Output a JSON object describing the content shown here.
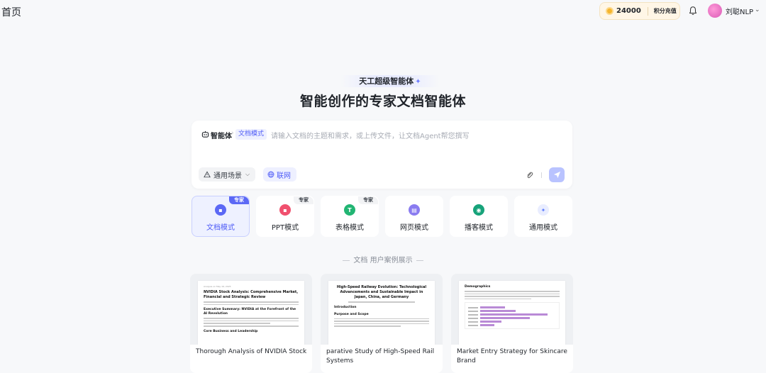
{
  "header": {
    "page_title": "首页",
    "credits": "24000",
    "recharge_label": "积分充值",
    "username": "刘聪NLP"
  },
  "hero": {
    "badge": "天工超级智能体",
    "title": "智能创作的专家文档智能体"
  },
  "composer": {
    "agent_label": "智能体",
    "mode_chip": "文档模式",
    "placeholder": "请输入文档的主题和需求，或上传文件，让文档Agent帮您撰写",
    "scene_label": "通用场景",
    "web_label": "联网"
  },
  "modes": [
    {
      "label": "文档模式",
      "tag": "专家",
      "icon": "doc-icon",
      "color": "#5b68f5"
    },
    {
      "label": "PPT模式",
      "tag": "专家",
      "icon": "ppt-icon",
      "color": "#f0506e"
    },
    {
      "label": "表格模式",
      "tag": "专家",
      "icon": "sheet-icon",
      "color": "#22b573"
    },
    {
      "label": "网页模式",
      "tag": "",
      "icon": "web-icon",
      "color": "#8a7cf0"
    },
    {
      "label": "播客模式",
      "tag": "",
      "icon": "podcast-icon",
      "color": "#17a37a"
    },
    {
      "label": "通用模式",
      "tag": "",
      "icon": "sparkle-icon",
      "color": "#5b7bff"
    }
  ],
  "showcase": {
    "title": "文档 用户案例展示",
    "cases": [
      {
        "caption": "Thorough Analysis of NVIDIA Stock",
        "doc_meta": "Analysis on May 16, 2025",
        "doc_title": "NVIDIA Stock Analysis: Comprehensive Market, Financial and Strategic Review",
        "doc_h2": "Executive Summary: NVIDIA at the Forefront of the AI Revolution",
        "doc_h3": "Core Business and Leadership"
      },
      {
        "caption": "parative Study of High-Speed Rail Systems",
        "doc_title": "High-Speed Railway Evolution: Technological Advancements and Sustainable Impact in Japan, China, and Germany",
        "doc_h2": "Introduction",
        "doc_h3": "Purpose and Scope"
      },
      {
        "caption": "Market Entry Strategy for Skincare Brand",
        "doc_h2": "Demographics",
        "bars": [
          0.35,
          0.5,
          0.95,
          0.7,
          0.3,
          0.2
        ]
      }
    ]
  }
}
